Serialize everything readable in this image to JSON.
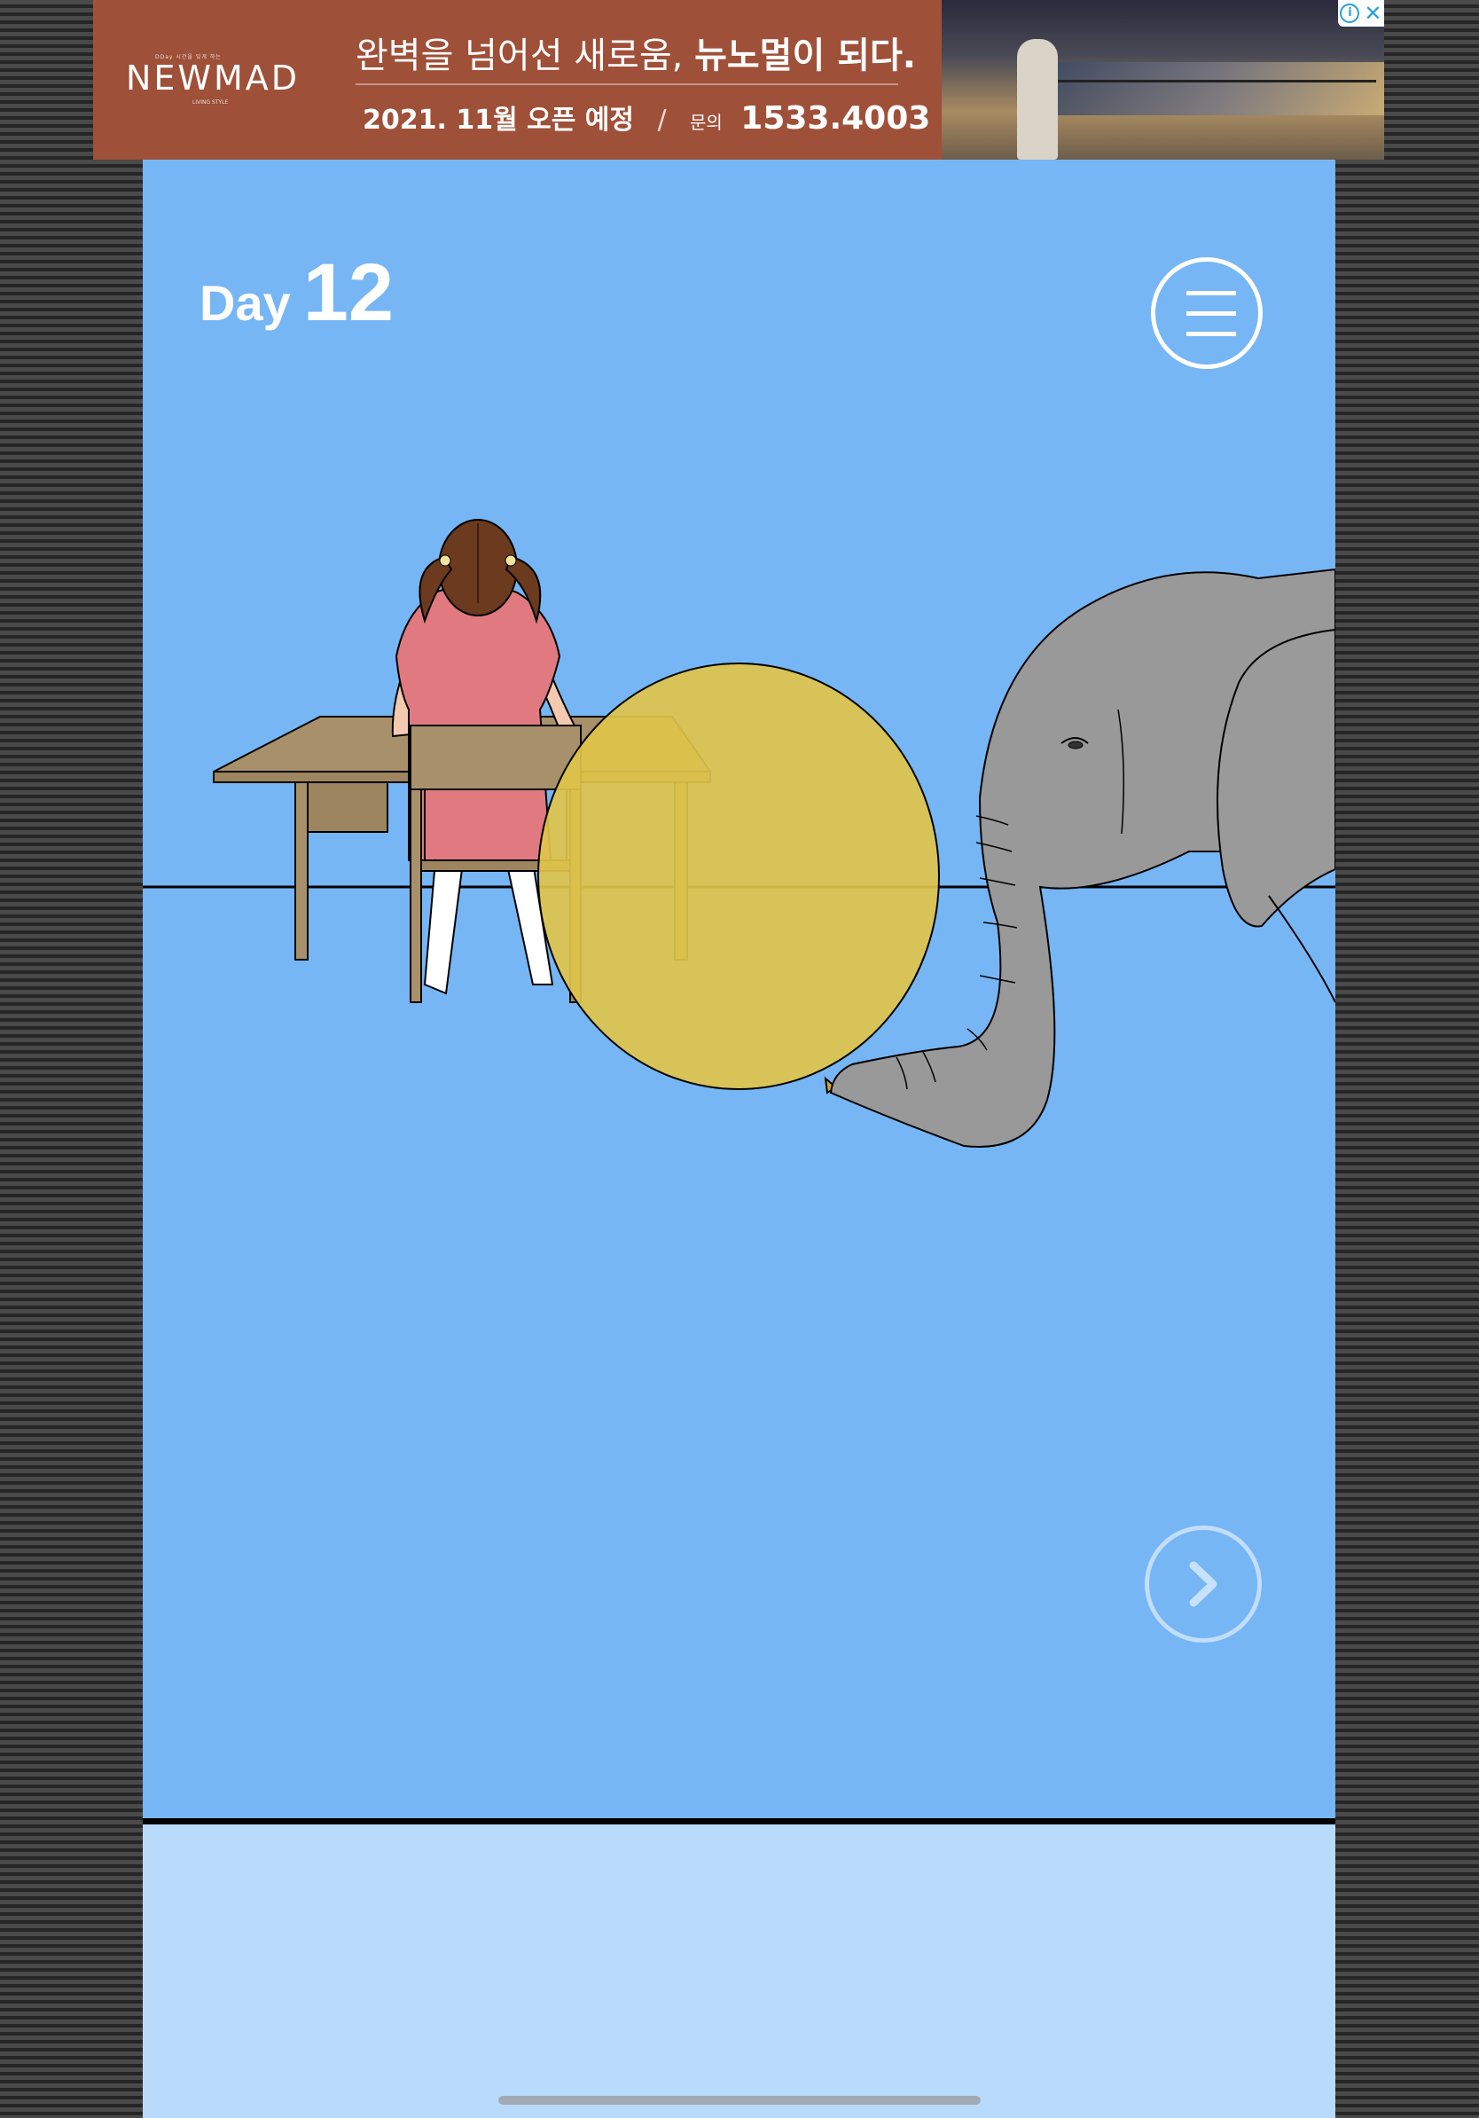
{
  "ad": {
    "logo_tagline": "DDay 시간을 잊게 하는",
    "logo": "NEWMAD",
    "logo_sub": "LIVING STYLE",
    "headline_regular": "완벽을 넘어선 새로움, ",
    "headline_bold": "뉴노멀이 되다.",
    "open_date": "2021. 11월 오픈 예정",
    "separator": "/",
    "contact_label": "문의",
    "contact_phone": "1533.4003",
    "info_icon": "info-icon",
    "close_icon": "close-icon"
  },
  "game": {
    "day_word": "Day",
    "day_number": "12",
    "menu_icon": "hamburger-menu-icon",
    "next_icon": "chevron-right-icon"
  },
  "colors": {
    "sky": "#76b6f5",
    "bottom_panel": "#b8dbfb",
    "balloon": "#e0c44a",
    "elephant": "#999999",
    "desk": "#a8916a",
    "dress": "#e07a80",
    "ad_background": "#9f5039"
  }
}
